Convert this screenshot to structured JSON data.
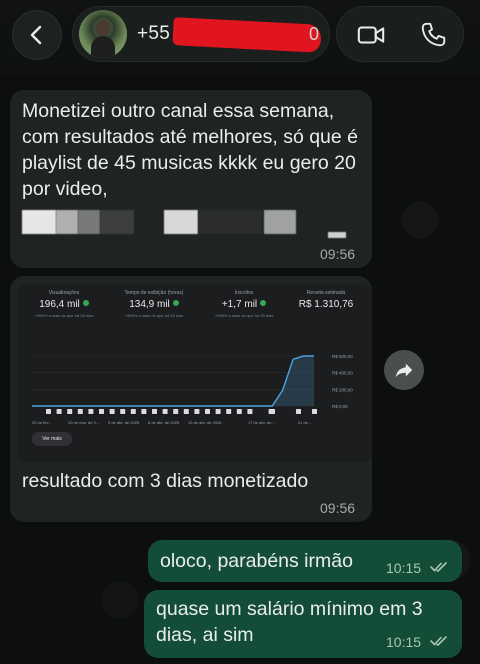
{
  "header": {
    "contact_name": "+55",
    "contact_name_tail": "0"
  },
  "messages": {
    "m1": {
      "text": "Monetizei outro canal essa semana, com resultados até melhores, só que é playlist de 45 musicas kkkk eu gero 20 por video,",
      "time": "09:56"
    },
    "m2": {
      "caption": "resultado com 3 dias monetizado",
      "time": "09:56",
      "screenshot": {
        "stats": [
          {
            "label": "Visualizações",
            "value": "196,4 mil",
            "sub": "+999% a mais do que há 28 dias"
          },
          {
            "label": "Tempo de exibição (horas)",
            "value": "134,9 mil",
            "sub": "+999% a mais do que há 28 dias"
          },
          {
            "label": "Inscritos",
            "value": "+1,7 mil",
            "sub": "+999% a mais do que há 28 dias"
          },
          {
            "label": "Receita estimada",
            "value": "R$ 1.310,76",
            "sub": ""
          }
        ],
        "y_ticks": [
          "R$ 600,00",
          "R$ 400,00",
          "R$ 200,00",
          "R$ 0,00"
        ],
        "x_ticks": [
          "25 de fev...",
          "20 de mar. de 2...",
          "9 de abr. de 2026",
          "8 de abr. de 2026",
          "12 de abr. de 2026",
          "17 de abr. de...",
          "21 de..."
        ],
        "see_more": "Ver mais"
      }
    },
    "m3": {
      "text": "oloco, parabéns irmão",
      "time": "10:15"
    },
    "m4": {
      "text": "quase um salário mínimo em 3 dias, ai sim",
      "time": "10:15"
    }
  },
  "chart_data": {
    "type": "line",
    "title": "",
    "ylabel": "",
    "ylim": [
      0,
      600
    ],
    "y_ticks": [
      "R$ 600,00",
      "R$ 400,00",
      "R$ 200,00",
      "R$ 0,00"
    ],
    "x": [
      0,
      1,
      2,
      3,
      4,
      5,
      6,
      7,
      8,
      9,
      10,
      11,
      12,
      13,
      14,
      15,
      16,
      17,
      18,
      19,
      20,
      21,
      22,
      23,
      24,
      25,
      26,
      27
    ],
    "series": [
      {
        "values": [
          0,
          0,
          0,
          0,
          0,
          0,
          0,
          0,
          0,
          0,
          0,
          0,
          0,
          0,
          0,
          0,
          0,
          0,
          0,
          0,
          0,
          0,
          0,
          0,
          190,
          560,
          600,
          600
        ]
      }
    ]
  },
  "colors": {
    "incoming_bubble": "#1f2322",
    "outgoing_bubble": "#144d37",
    "chart_line": "#4fa3e0",
    "redaction": "#e0151f"
  },
  "icons": [
    "back-arrow-icon",
    "video-call-icon",
    "phone-icon",
    "forward-icon",
    "double-check-icon"
  ]
}
